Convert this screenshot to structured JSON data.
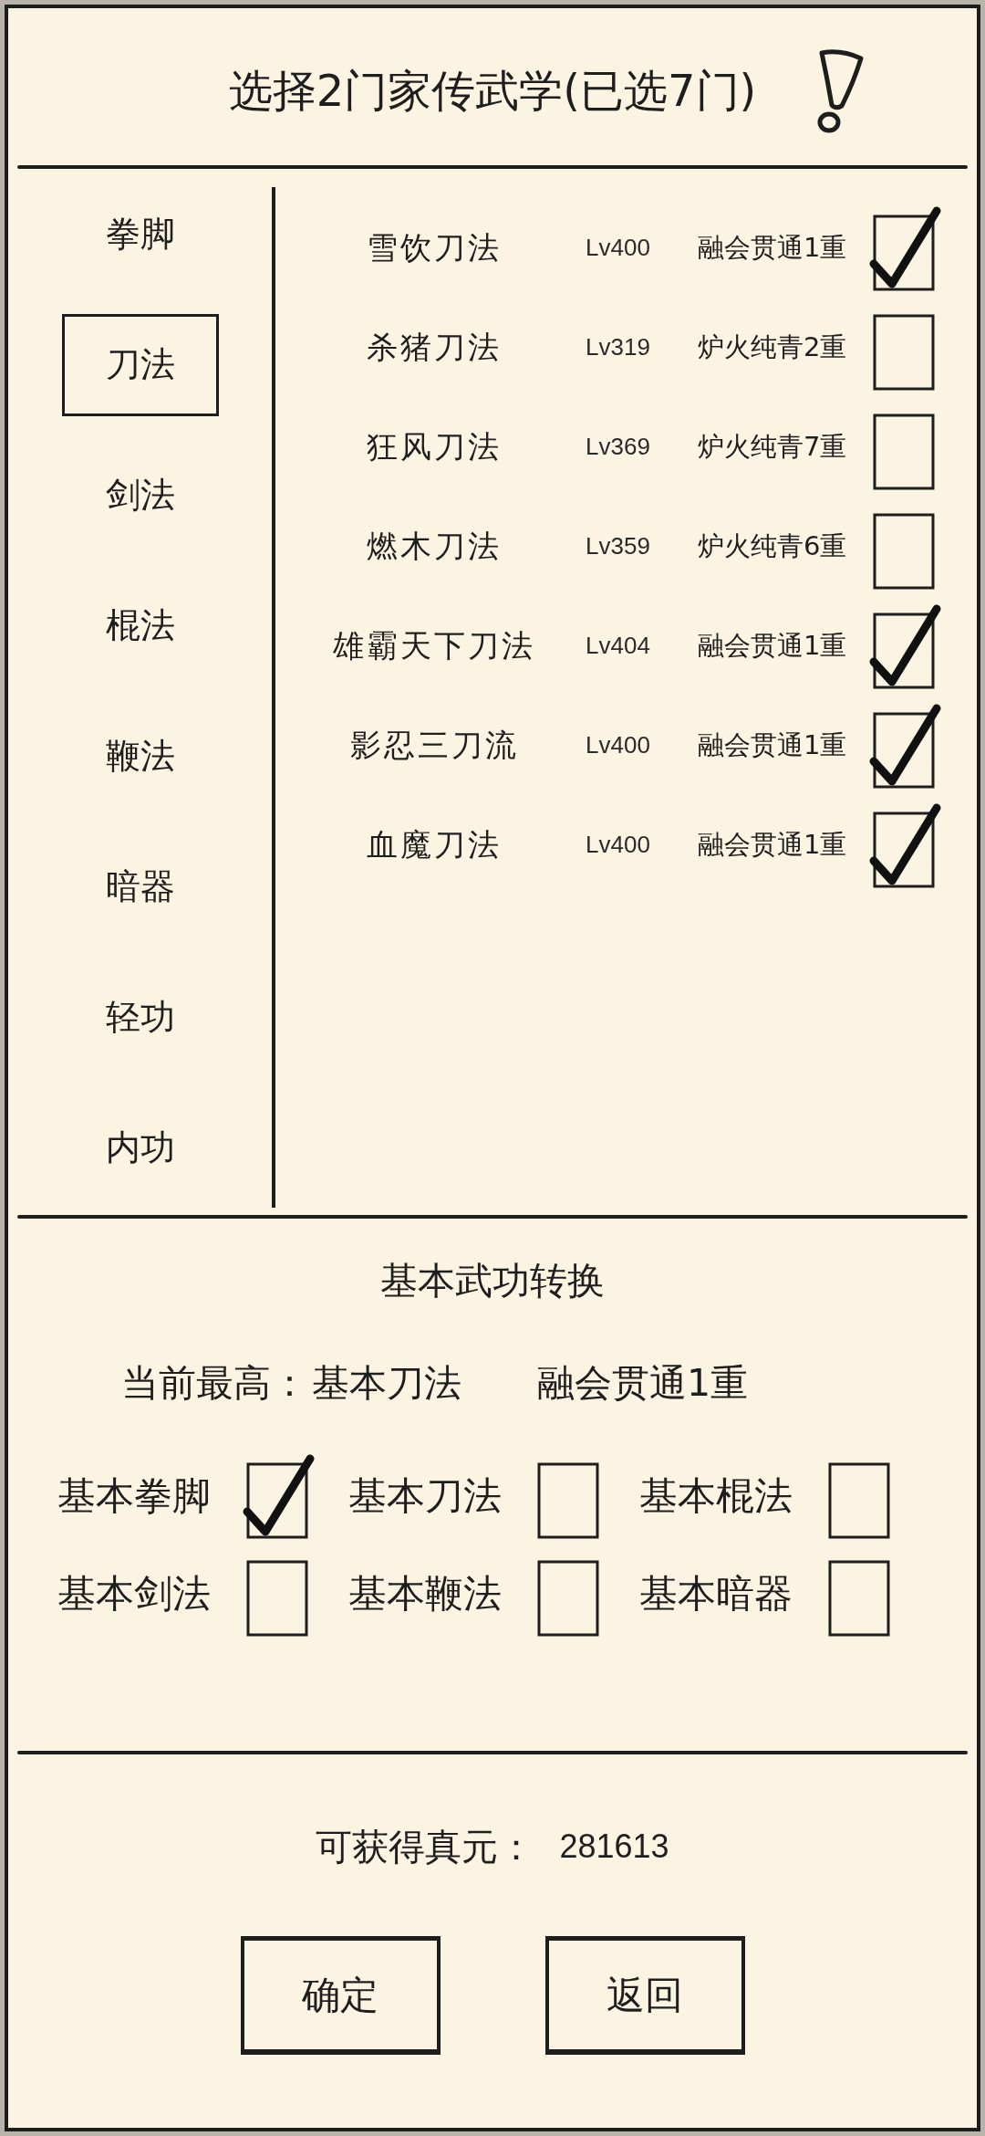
{
  "header": {
    "title": "选择2门家传武学(已选7门)"
  },
  "categories": [
    {
      "label": "拳脚",
      "selected": false
    },
    {
      "label": "刀法",
      "selected": true
    },
    {
      "label": "剑法",
      "selected": false
    },
    {
      "label": "棍法",
      "selected": false
    },
    {
      "label": "鞭法",
      "selected": false
    },
    {
      "label": "暗器",
      "selected": false
    },
    {
      "label": "轻功",
      "selected": false
    },
    {
      "label": "内功",
      "selected": false
    }
  ],
  "skills": [
    {
      "name": "雪饮刀法",
      "level_text": "Lv400",
      "rank": "融会贯通1重",
      "checked": true
    },
    {
      "name": "杀猪刀法",
      "level_text": "Lv319",
      "rank": "炉火纯青2重",
      "checked": false
    },
    {
      "name": "狂风刀法",
      "level_text": "Lv369",
      "rank": "炉火纯青7重",
      "checked": false
    },
    {
      "name": "燃木刀法",
      "level_text": "Lv359",
      "rank": "炉火纯青6重",
      "checked": false
    },
    {
      "name": "雄霸天下刀法",
      "level_text": "Lv404",
      "rank": "融会贯通1重",
      "checked": true
    },
    {
      "name": "影忍三刀流",
      "level_text": "Lv400",
      "rank": "融会贯通1重",
      "checked": true
    },
    {
      "name": "血魔刀法",
      "level_text": "Lv400",
      "rank": "融会贯通1重",
      "checked": true
    }
  ],
  "conversion": {
    "title": "基本武功转换",
    "current_label": "当前最高：",
    "current_skill": "基本刀法",
    "current_rank": "融会贯通1重",
    "options": [
      {
        "label": "基本拳脚",
        "checked": true
      },
      {
        "label": "基本刀法",
        "checked": false
      },
      {
        "label": "基本棍法",
        "checked": false
      },
      {
        "label": "基本剑法",
        "checked": false
      },
      {
        "label": "基本鞭法",
        "checked": false
      },
      {
        "label": "基本暗器",
        "checked": false
      }
    ]
  },
  "reward": {
    "label": "可获得真元：",
    "value": "281613"
  },
  "buttons": [
    "确定",
    "返回"
  ]
}
